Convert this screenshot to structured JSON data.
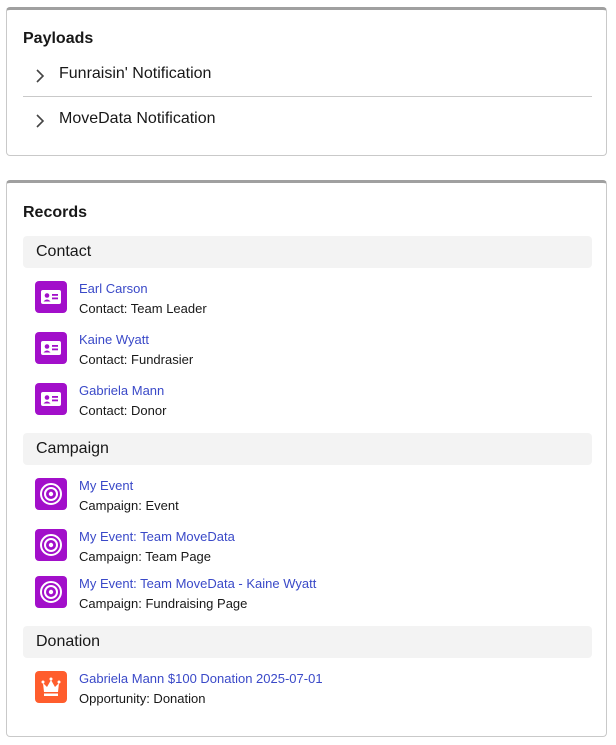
{
  "payloads": {
    "title": "Payloads",
    "items": [
      {
        "label": "Funraisin' Notification"
      },
      {
        "label": "MoveData Notification"
      }
    ]
  },
  "records": {
    "title": "Records",
    "sections": [
      {
        "title": "Contact",
        "items": [
          {
            "name": "Earl Carson",
            "subtitle": "Contact: Team Leader",
            "icon": "contact-card-icon"
          },
          {
            "name": "Kaine Wyatt",
            "subtitle": "Contact: Fundrasier",
            "icon": "contact-card-icon"
          },
          {
            "name": "Gabriela Mann",
            "subtitle": "Contact: Donor",
            "icon": "contact-card-icon"
          }
        ]
      },
      {
        "title": "Campaign",
        "items": [
          {
            "name": "My Event",
            "subtitle": "Campaign: Event",
            "icon": "campaign-target-icon"
          },
          {
            "name": "My Event: Team MoveData",
            "subtitle": "Campaign: Team Page",
            "icon": "campaign-target-icon"
          },
          {
            "name": "My Event: Team MoveData - Kaine Wyatt",
            "subtitle": "Campaign: Fundraising Page",
            "icon": "campaign-target-icon"
          }
        ]
      },
      {
        "title": "Donation",
        "items": [
          {
            "name": "Gabriela Mann $100 Donation 2025-07-01",
            "subtitle": "Opportunity: Donation",
            "icon": "opportunity-crown-icon"
          }
        ]
      }
    ]
  },
  "colors": {
    "link": "#3a49c8",
    "contact_icon_bg": "#a20fca",
    "campaign_icon_bg": "#a20fca",
    "opportunity_icon_bg": "#ff5d2d",
    "section_header_bg": "#f3f3f3"
  }
}
